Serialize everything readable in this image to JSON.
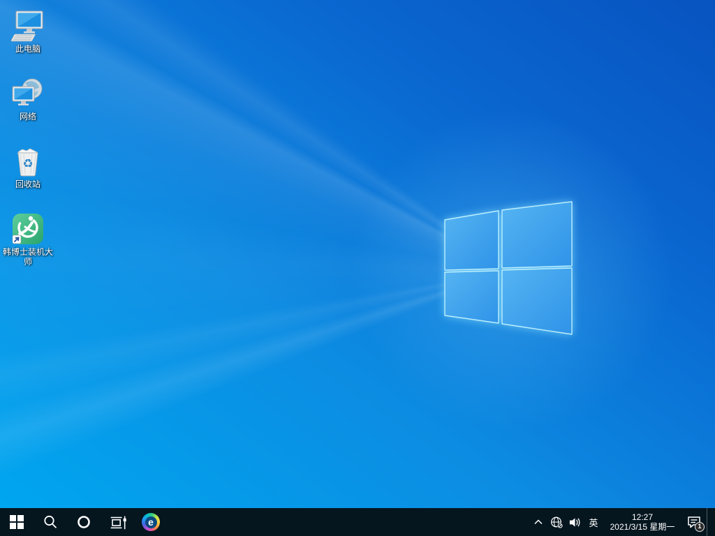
{
  "desktop": {
    "icons": [
      {
        "label": "此电脑"
      },
      {
        "label": "网络"
      },
      {
        "label": "回收站"
      },
      {
        "label": "韩博士装机大师"
      }
    ]
  },
  "taskbar": {
    "tray": {
      "language": "英",
      "time": "12:27",
      "date": "2021/3/15 星期一",
      "notification_count": "1"
    }
  },
  "edge_letter": "e",
  "colors": {
    "wallpaper_dark": "#0853c0",
    "wallpaper_bright": "#00a6f0",
    "logo_pane": "#3fa2ee",
    "logo_edge": "#baeffd",
    "taskbar_bg": "#05161f",
    "app_icon_green": "#3cb87e"
  }
}
